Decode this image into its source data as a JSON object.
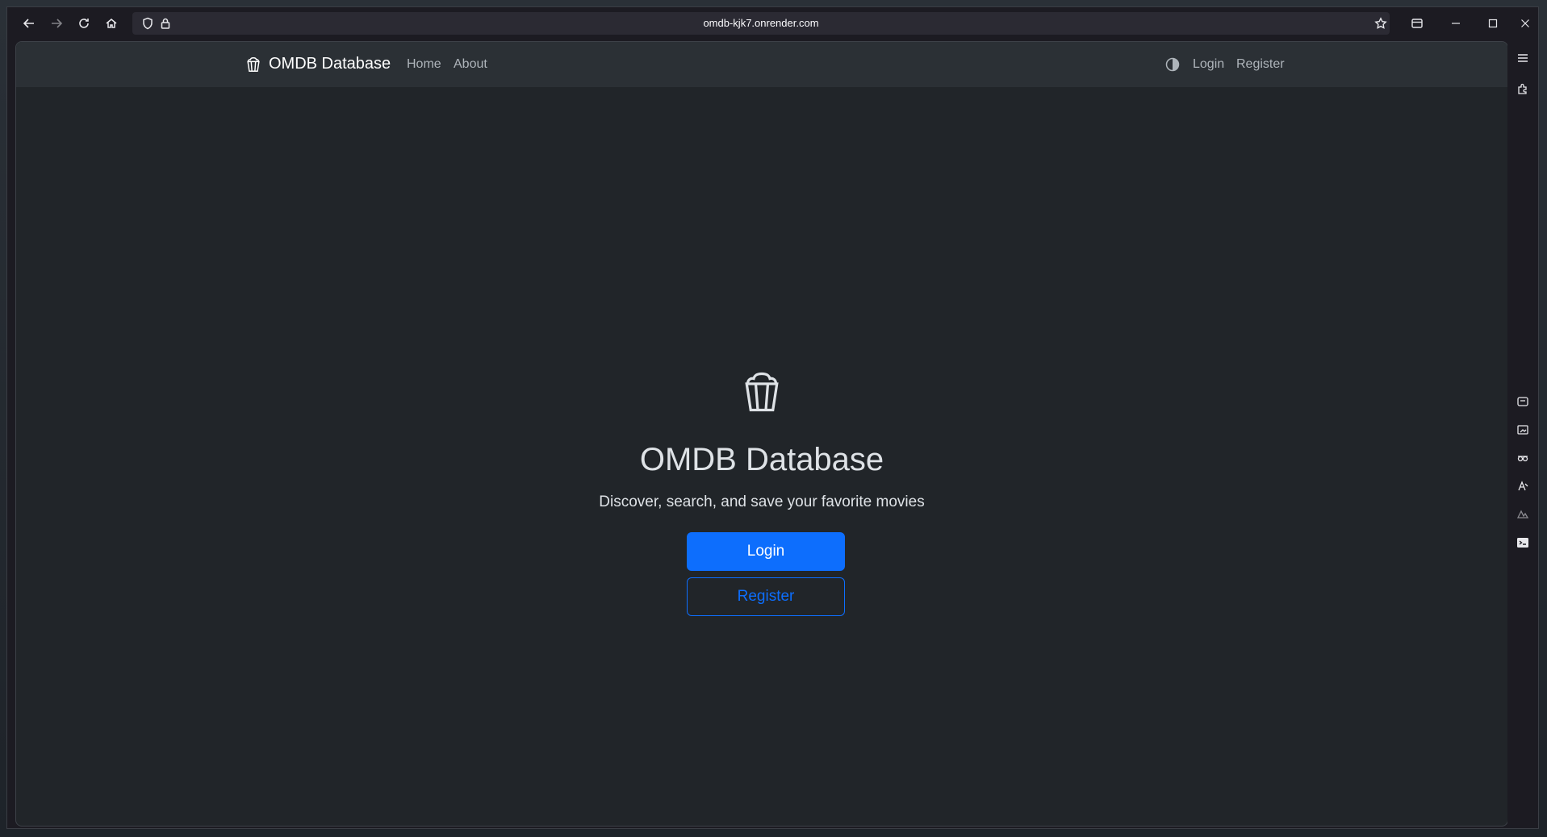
{
  "browser": {
    "url": "omdb-kjk7.onrender.com"
  },
  "navbar": {
    "brand": "OMDB Database",
    "links": [
      "Home",
      "About"
    ],
    "login": "Login",
    "register": "Register"
  },
  "hero": {
    "title": "OMDB Database",
    "subtitle": "Discover, search, and save your favorite movies",
    "login_button": "Login",
    "register_button": "Register"
  },
  "colors": {
    "primary": "#0d6efd",
    "page_bg": "#212529",
    "navbar_bg": "#2b3035"
  }
}
